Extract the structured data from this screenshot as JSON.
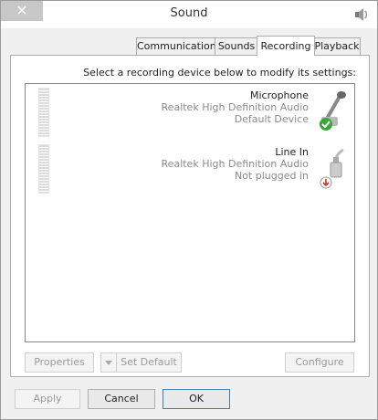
{
  "window": {
    "title": "Sound",
    "close_glyph": "✕",
    "icon": "speaker-icon"
  },
  "tabs": [
    {
      "label": "Communications"
    },
    {
      "label": "Sounds"
    },
    {
      "label": "Recording",
      "active": true
    },
    {
      "label": "Playback"
    }
  ],
  "panel": {
    "instruction": "Select a recording device below to modify its settings:",
    "devices": [
      {
        "name": "Microphone",
        "driver": "Realtek High Definition Audio",
        "status": "Default Device",
        "icon": "microphone-icon",
        "status_badge": "check-icon"
      },
      {
        "name": "Line In",
        "driver": "Realtek High Definition Audio",
        "status": "Not plugged in",
        "icon": "line-in-jack-icon",
        "status_badge": "down-arrow-icon"
      }
    ],
    "buttons": {
      "properties": "Properties",
      "set_default": "Set Default",
      "configure": "Configure"
    }
  },
  "footer": {
    "ok": "OK",
    "cancel": "Cancel",
    "apply": "Apply"
  },
  "colors": {
    "accent": "#3c7fb1",
    "check": "#3aa53a",
    "warn": "#c0392b"
  }
}
